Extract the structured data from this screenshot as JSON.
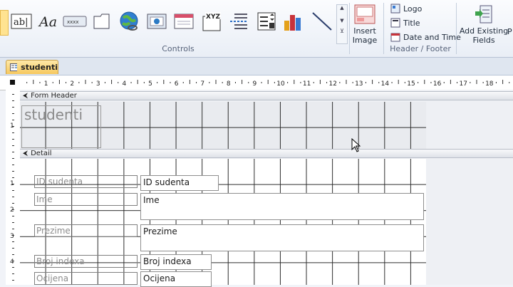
{
  "ribbon": {
    "controls_group_label": "Controls",
    "header_footer_group_label": "Header / Footer",
    "controls": [
      {
        "name": "text-box-icon",
        "text": "ab|"
      },
      {
        "name": "label-icon",
        "text": "Aa"
      },
      {
        "name": "button-icon",
        "text": "xxxx"
      },
      {
        "name": "tab-control-icon"
      },
      {
        "name": "hyperlink-icon"
      },
      {
        "name": "web-browser-icon"
      },
      {
        "name": "navigation-control-icon"
      },
      {
        "name": "option-group-icon",
        "text": "XYZ"
      },
      {
        "name": "page-break-icon"
      },
      {
        "name": "combo-box-icon"
      },
      {
        "name": "chart-icon"
      },
      {
        "name": "line-icon"
      }
    ],
    "insert_image_label": "Insert\nImage",
    "header_footer_items": [
      "Logo",
      "Title",
      "Date and Time"
    ],
    "add_existing_label": "Add Existing\nFields",
    "overflow_label": "P"
  },
  "tab": {
    "label": "studenti"
  },
  "ruler_numbers": [
    "1",
    "2",
    "3",
    "4",
    "5",
    "6",
    "7",
    "8",
    "9",
    "10",
    "11",
    "12",
    "13",
    "14",
    "15",
    "16",
    "17",
    "18"
  ],
  "vruler_numbers": [
    "1",
    "1",
    "2",
    "3",
    "4"
  ],
  "sections": {
    "form_header": "Form Header",
    "detail": "Detail"
  },
  "form_title": "studenti",
  "fields": [
    {
      "label": "ID sudenta",
      "value": "ID sudenta"
    },
    {
      "label": "Ime",
      "value": "Ime"
    },
    {
      "label": "Prezime",
      "value": "Prezime"
    },
    {
      "label": "Broj indexa",
      "value": "Broj indexa"
    },
    {
      "label": "Ocijena",
      "value": "Ocijena"
    }
  ]
}
